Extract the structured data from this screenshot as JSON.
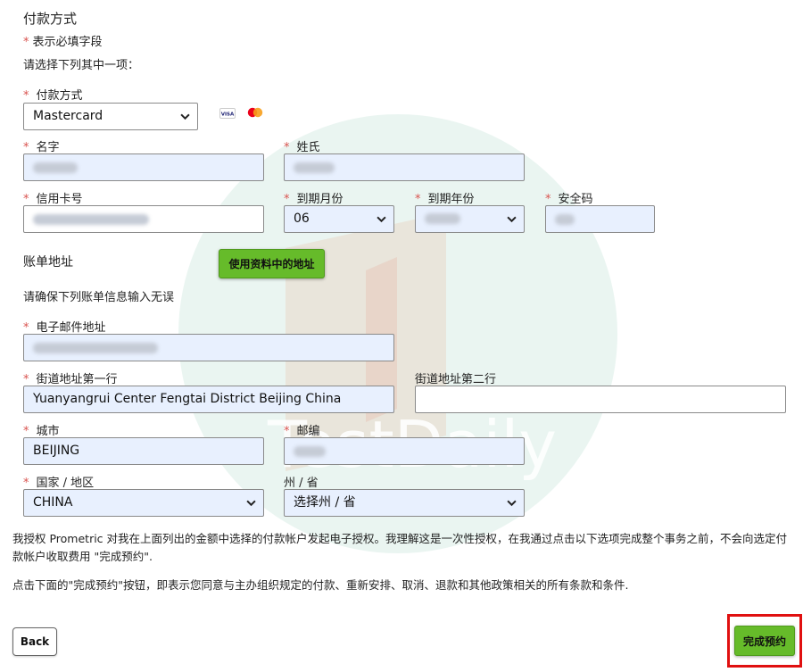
{
  "section_title": "付款方式",
  "required_note_star": "*",
  "required_note": "表示必填字段",
  "choose_one": "请选择下列其中一项：",
  "payment": {
    "label": "付款方式",
    "selected": "Mastercard",
    "card_icons": [
      "visa-icon",
      "mastercard-icon"
    ],
    "visa_text": "VISA"
  },
  "first_name": {
    "label": "名字"
  },
  "last_name": {
    "label": "姓氏"
  },
  "card_number": {
    "label": "信用卡号"
  },
  "exp_month": {
    "label": "到期月份",
    "selected": "06"
  },
  "exp_year": {
    "label": "到期年份"
  },
  "cvv": {
    "label": "安全码"
  },
  "billing": {
    "title": "账单地址",
    "use_profile_button": "使用资料中的地址",
    "confirm_note": "请确保下列账单信息输入无误"
  },
  "email": {
    "label": "电子邮件地址"
  },
  "street1": {
    "label": "街道地址第一行",
    "value": "Yuanyangrui Center Fengtai District Beijing China"
  },
  "street2": {
    "label": "街道地址第二行",
    "value": ""
  },
  "city": {
    "label": "城市",
    "value": "BEIJING"
  },
  "postal": {
    "label": "邮编"
  },
  "country": {
    "label": "国家 / 地区",
    "selected": "CHINA"
  },
  "state": {
    "label": "州 / 省",
    "selected": "选择州 / 省"
  },
  "authorization_text": "我授权 Prometric 对我在上面列出的金额中选择的付款帐户发起电子授权。我理解这是一次性授权，在我通过点击以下选项完成整个事务之前，不会向选定付款帐户收取费用 \"完成预约\".",
  "terms_text": "点击下面的\"完成预约\"按钮，即表示您同意与主办组织规定的付款、重新安排、取消、退款和其他政策相关的所有条款和条件.",
  "back_button": "Back",
  "complete_button": "完成预约",
  "watermark_text": "TestDaily",
  "colors": {
    "accent_green": "#66bb2a",
    "required_red": "#d9534f",
    "highlight_red": "#e01010",
    "autofill_blue": "#e8f0fe"
  }
}
